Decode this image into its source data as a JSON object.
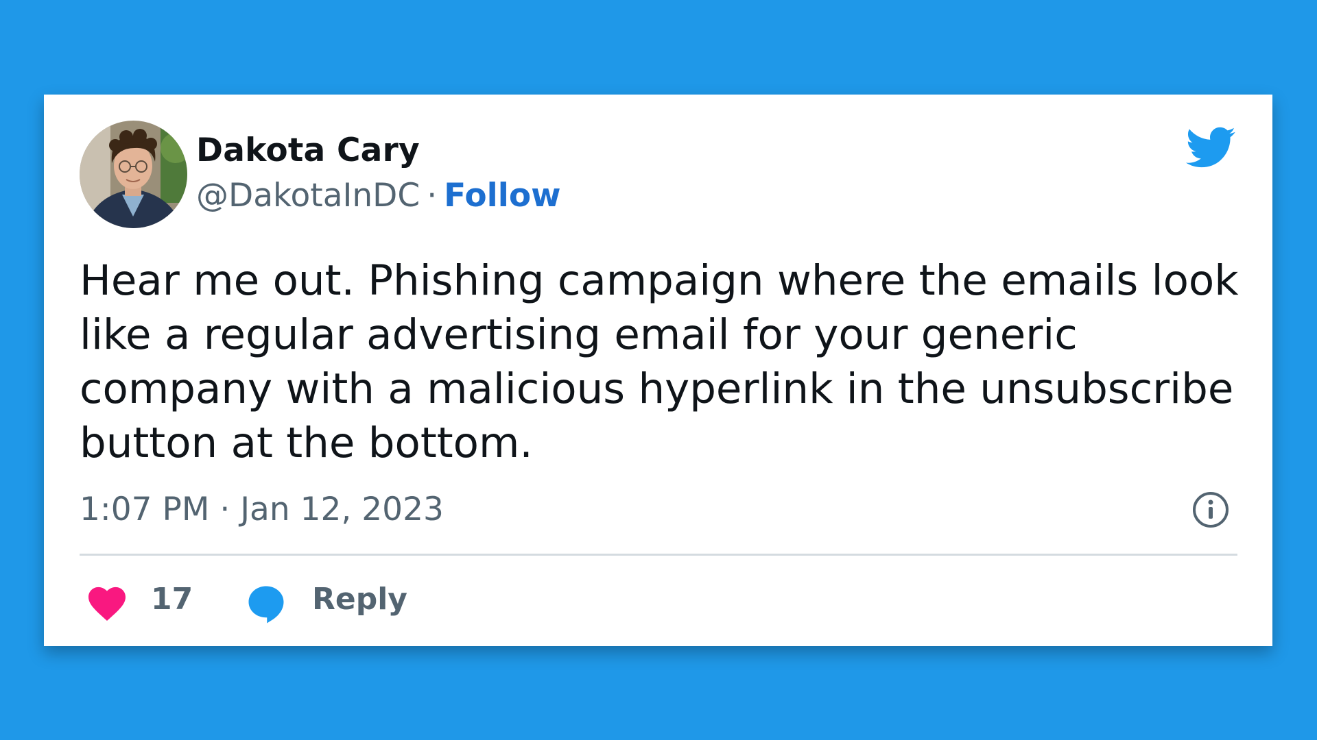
{
  "tweet": {
    "author": {
      "display_name": "Dakota Cary",
      "handle": "@DakotaInDC",
      "separator": "·",
      "follow_label": "Follow"
    },
    "text": "Hear me out. Phishing campaign where the emails look\nlike a regular advertising email for your generic\ncompany with a malicious hyperlink in the unsubscribe\nbutton at the bottom.",
    "timestamp": "1:07 PM · Jan 12, 2023",
    "likes": "17",
    "reply_label": "Reply"
  },
  "icons": {
    "brand": "twitter-bird-icon",
    "info": "info-icon",
    "like": "heart-icon",
    "reply": "speech-bubble-icon"
  },
  "colors": {
    "background": "#1f98e8",
    "card": "#ffffff",
    "text": "#0f1419",
    "secondary_text": "#536471",
    "link": "#1d6fd0",
    "twitter_blue": "#1d9bf0",
    "heart": "#f91880",
    "divider": "#d4dbe0"
  }
}
